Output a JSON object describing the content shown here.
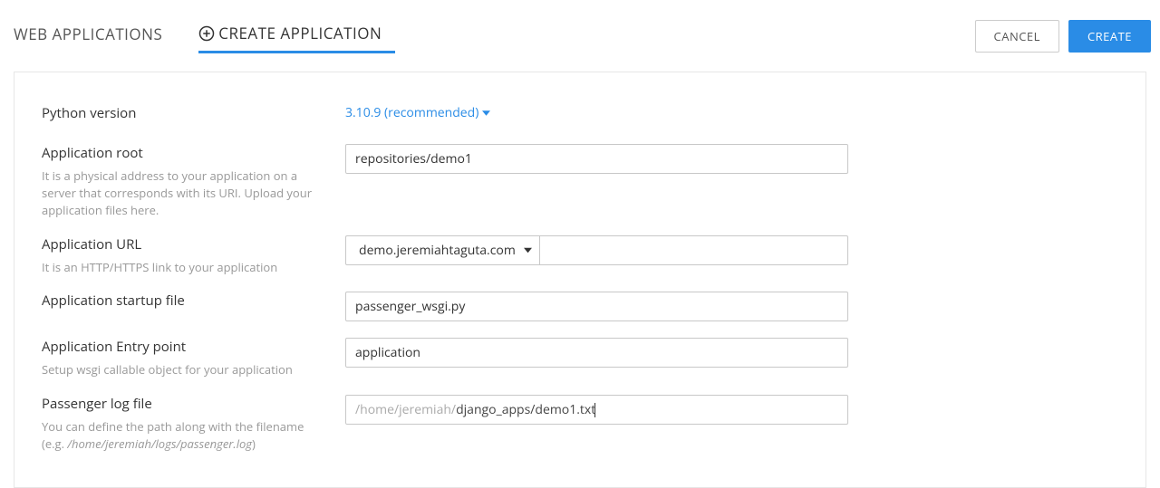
{
  "tabs": {
    "web_apps": "WEB APPLICATIONS",
    "create_app": "CREATE APPLICATION"
  },
  "buttons": {
    "cancel": "CANCEL",
    "create": "CREATE"
  },
  "form": {
    "python_version": {
      "label": "Python version",
      "value": "3.10.9 (recommended)"
    },
    "app_root": {
      "label": "Application root",
      "hint": "It is a physical address to your application on a server that corresponds with its URI. Upload your application files here.",
      "value": "repositories/demo1"
    },
    "app_url": {
      "label": "Application URL",
      "hint": "It is an HTTP/HTTPS link to your application",
      "domain": "demo.jeremiahtaguta.com",
      "path": ""
    },
    "startup_file": {
      "label": "Application startup file",
      "value": "passenger_wsgi.py"
    },
    "entry_point": {
      "label": "Application Entry point",
      "hint": "Setup wsgi callable object for your application",
      "value": "application"
    },
    "passenger_log": {
      "label": "Passenger log file",
      "hint_pre": "You can define the path along with the filename (e.g.",
      "hint_italic": "/home/jeremiah/logs/passenger.log",
      "hint_post": ")",
      "prefix": "/home/jeremiah/",
      "value": "django_apps/demo1.txt"
    }
  }
}
